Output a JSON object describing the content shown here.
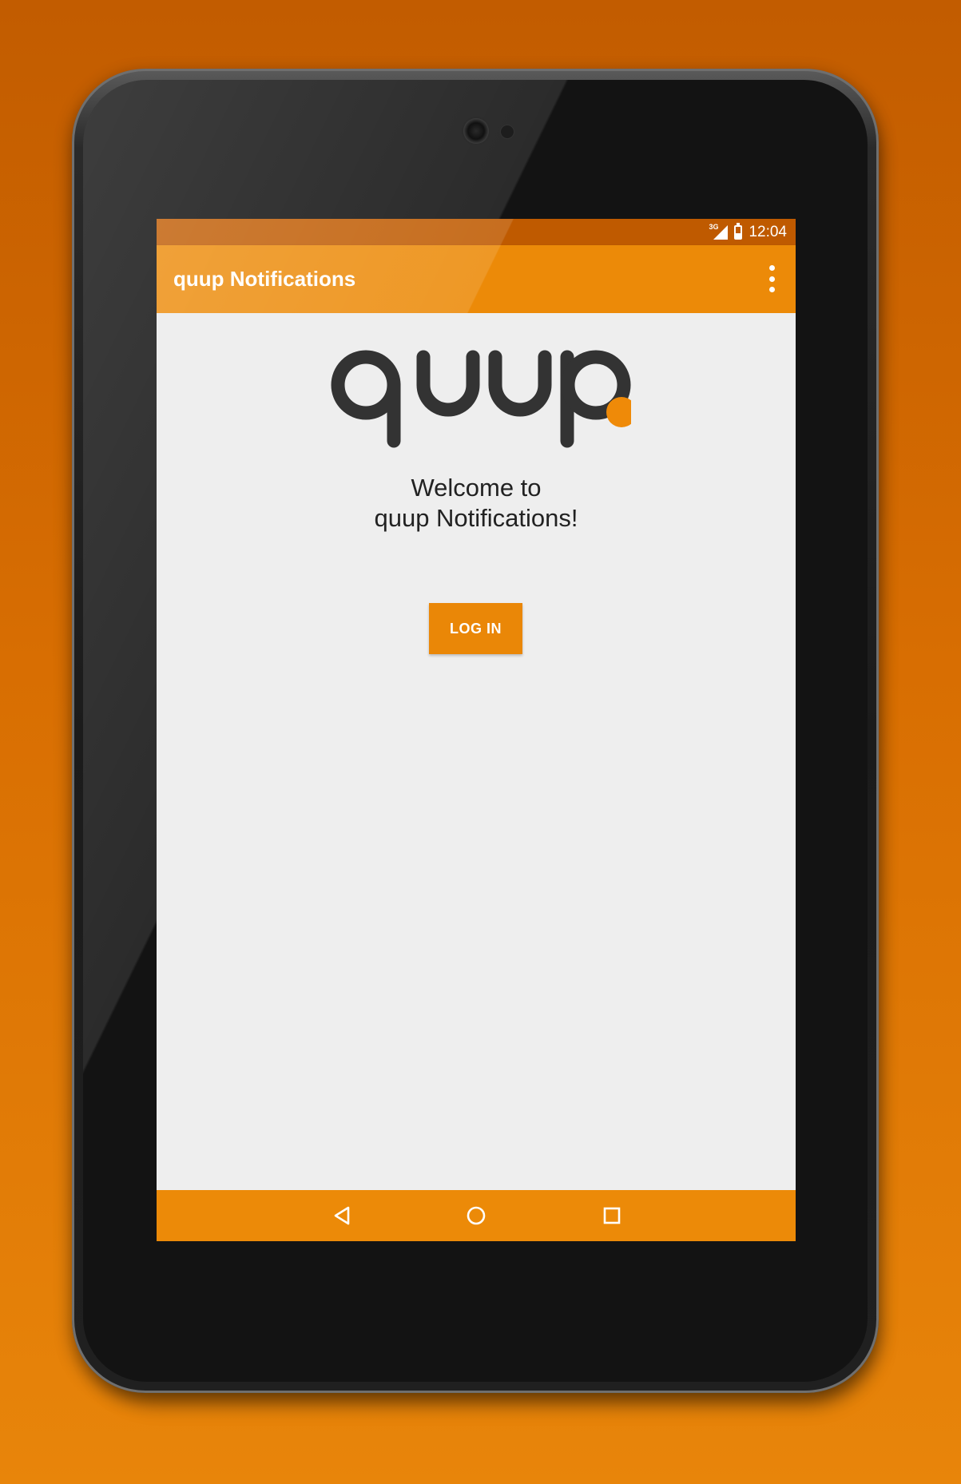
{
  "status_bar": {
    "network": "3G",
    "time": "12:04"
  },
  "app_bar": {
    "title": "quup Notifications",
    "menu_icon": "overflow-menu-icon"
  },
  "main": {
    "logo_text": "quup",
    "welcome_line1": "Welcome to",
    "welcome_line2": "quup Notifications!",
    "login_label": "LOG IN"
  },
  "nav_bar": {
    "back_icon": "back-icon",
    "home_icon": "home-icon",
    "recents_icon": "recents-icon"
  },
  "colors": {
    "accent": "#ec8a08",
    "status_bar": "#bf5a00",
    "background": "#eeeeee",
    "logo_dark": "#333333",
    "logo_dot": "#ef8a08"
  }
}
